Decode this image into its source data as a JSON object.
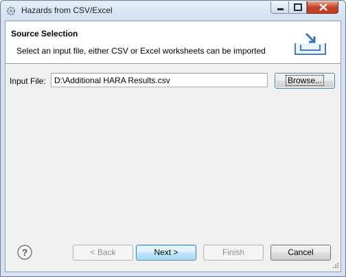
{
  "window": {
    "title": "Hazards from CSV/Excel"
  },
  "banner": {
    "title": "Source Selection",
    "description": "Select an input file, either CSV or Excel worksheets can be imported"
  },
  "form": {
    "input_label": "Input File:",
    "input_value": "D:\\Additional HARA Results.csv",
    "browse_label": "Browse..."
  },
  "buttons": {
    "back": "< Back",
    "next": "Next >",
    "finish": "Finish",
    "cancel": "Cancel"
  },
  "icons": {
    "app": "gear-icon",
    "banner": "import-tray-icon",
    "help": "help-icon"
  },
  "colors": {
    "titlebar": "#d2dfee",
    "client_bg": "#f0f0f0",
    "close_button": "#c7442a",
    "default_button": "#3c7fb1"
  }
}
